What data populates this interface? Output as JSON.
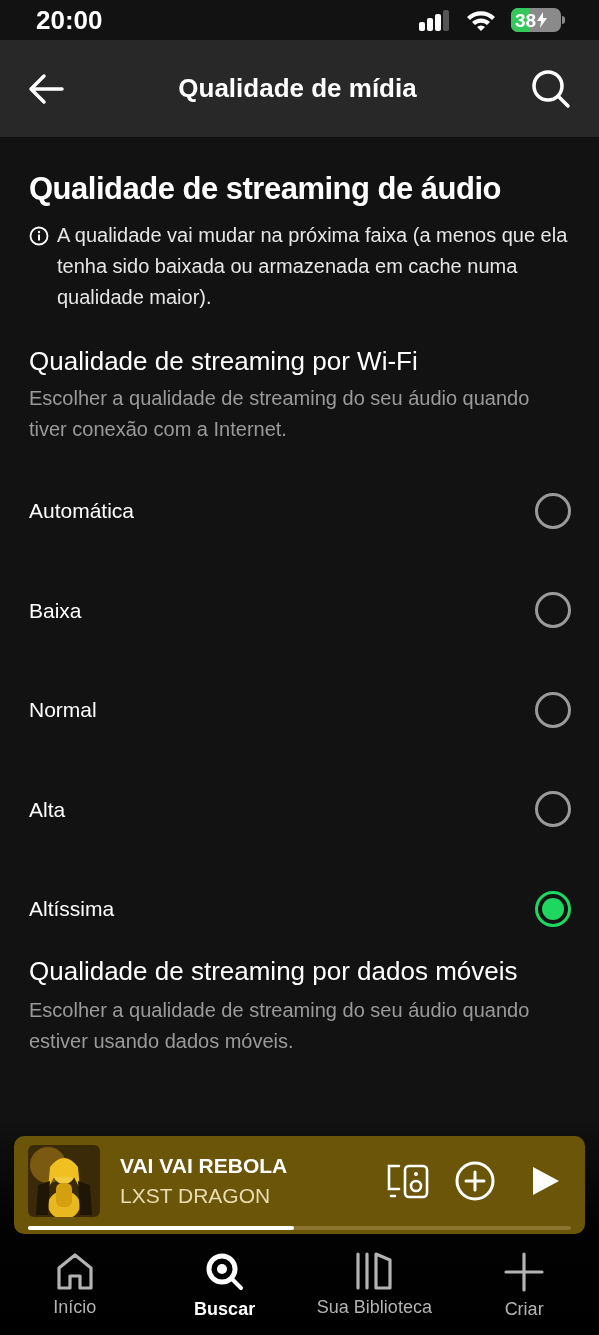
{
  "status_bar": {
    "time": "20:00",
    "battery": "38"
  },
  "header": {
    "title": "Qualidade de mídia"
  },
  "section": {
    "title": "Qualidade de streaming de áudio",
    "info": "A qualidade vai mudar na próxima faixa (a menos que ela tenha sido baixada ou armazenada em cache numa qualidade maior)."
  },
  "wifi": {
    "title": "Qualidade de streaming por Wi-Fi",
    "description": "Escolher a qualidade de streaming do seu áudio quando tiver conexão com a Internet.",
    "options": [
      {
        "label": "Automática",
        "selected": false
      },
      {
        "label": "Baixa",
        "selected": false
      },
      {
        "label": "Normal",
        "selected": false
      },
      {
        "label": "Alta",
        "selected": false
      },
      {
        "label": "Altíssima",
        "selected": true
      }
    ]
  },
  "mobile": {
    "title": "Qualidade de streaming por dados móveis",
    "description": "Escolher a qualidade de streaming do seu áudio quando estiver usando dados móveis."
  },
  "player": {
    "title": "VAI VAI REBOLA",
    "artist": "LXST DRAGON",
    "level": 0.49
  },
  "nav": [
    {
      "label": "Início",
      "kind": "home",
      "selected": false
    },
    {
      "label": "Buscar",
      "kind": "search",
      "selected": true
    },
    {
      "label": "Sua Biblioteca",
      "kind": "library",
      "selected": false
    },
    {
      "label": "Criar",
      "kind": "create",
      "selected": false
    }
  ]
}
